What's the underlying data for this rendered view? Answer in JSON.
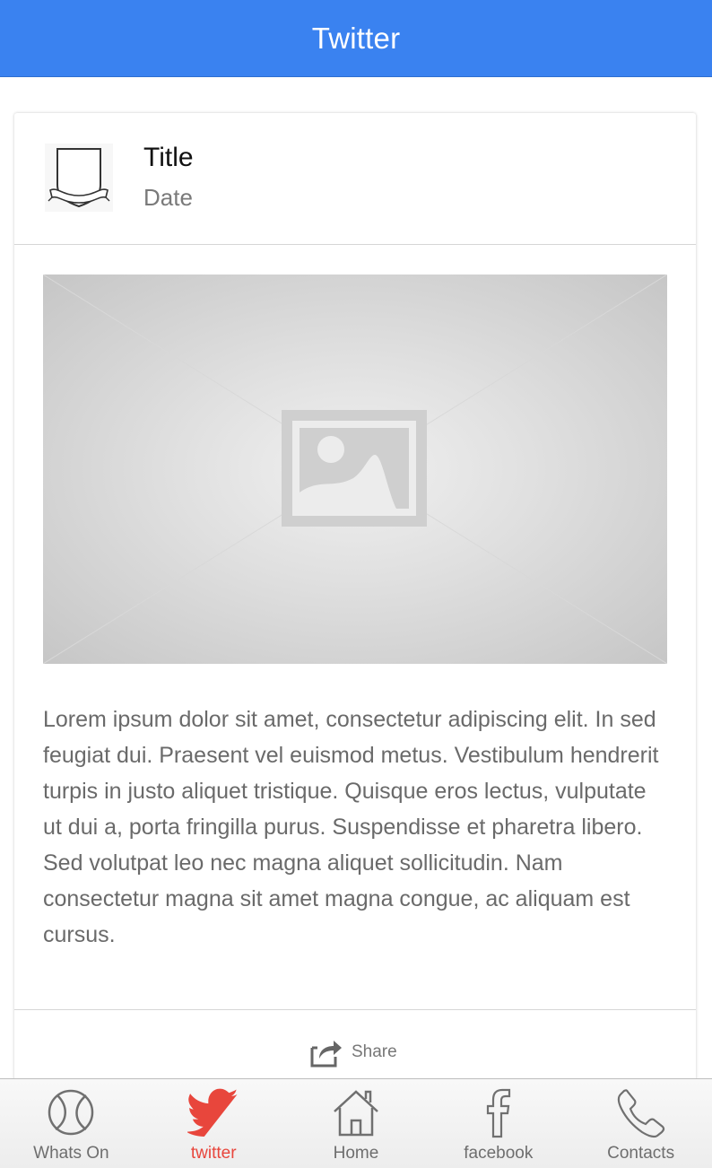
{
  "header": {
    "title": "Twitter",
    "color": "#3a82f0"
  },
  "card": {
    "title": "Title",
    "date": "Date",
    "avatar_icon": "shield-crest-icon",
    "image_icon": "image-placeholder-icon",
    "body": "Lorem ipsum dolor sit amet, consectetur adipiscing elit. In sed feugiat dui. Praesent vel euismod metus. Vestibulum hendrerit turpis in justo aliquet tristique. Quisque eros lectus, vulputate ut dui a, porta fringilla purus. Suspendisse et pharetra libero. Sed volutpat leo nec magna aliquet sollicitudin. Nam consectetur magna sit amet magna congue, ac aliquam est cursus.",
    "share": {
      "label": "Share",
      "icon": "share-icon"
    }
  },
  "tabbar": {
    "active_color": "#e8463c",
    "tabs": [
      {
        "label": "Whats On",
        "icon": "ball-icon",
        "active": false
      },
      {
        "label": "twitter",
        "icon": "twitter-bird-icon",
        "active": true
      },
      {
        "label": "Home",
        "icon": "home-icon",
        "active": false
      },
      {
        "label": "facebook",
        "icon": "facebook-icon",
        "active": false
      },
      {
        "label": "Contacts",
        "icon": "phone-icon",
        "active": false
      }
    ]
  }
}
